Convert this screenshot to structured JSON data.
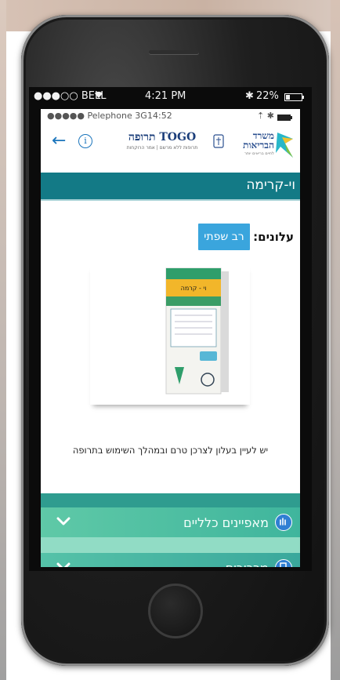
{
  "outer_status": {
    "carrier": "●●●○○ BELL",
    "time": "4:21 PM",
    "battery": "22%"
  },
  "inner_status": {
    "carrier": "●●●●● Pelephone  3G",
    "time": "14:52"
  },
  "header": {
    "app_title": "תרופה TOGO",
    "app_subtitle": "תרופות ללא מרשם | אמר הרוקחות",
    "ministry_line1": "משרד",
    "ministry_line2": "הבריאות",
    "ministry_sub": "לחיים בריאים יותר"
  },
  "product": {
    "name": "וי-קרימה",
    "leaflets_label": "עלונים:",
    "leaflet_button": "רב שפתי",
    "note": "יש לעיין בעלון לצרכן טרם ובמהלך השימוש בתרופה",
    "package_label": "וי - קרמה"
  },
  "accordion": [
    {
      "label": "מאפיינים כלליים",
      "icon": "info-hand-icon"
    },
    {
      "label": "מרכיבים",
      "icon": "ingredients-icon"
    }
  ],
  "colors": {
    "title_bar": "#137a86",
    "leaflet_button": "#3aa5dd",
    "accordion": "#4dbfa3"
  }
}
